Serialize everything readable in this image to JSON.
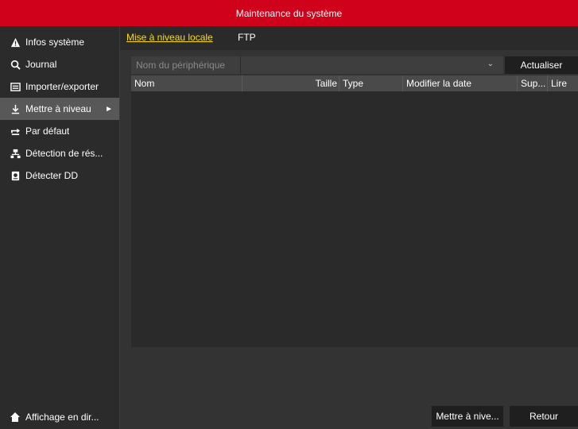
{
  "title": "Maintenance du système",
  "sidebar": {
    "items": [
      {
        "label": "Infos système",
        "icon": "warning-icon"
      },
      {
        "label": "Journal",
        "icon": "search-icon"
      },
      {
        "label": "Importer/exporter",
        "icon": "import-export-icon"
      },
      {
        "label": "Mettre à niveau",
        "icon": "download-icon",
        "active": true
      },
      {
        "label": "Par défaut",
        "icon": "reset-icon"
      },
      {
        "label": "Détection de rés...",
        "icon": "network-icon"
      },
      {
        "label": "Détecter DD",
        "icon": "disk-icon"
      }
    ],
    "live_view_label": "Affichage en dir..."
  },
  "tabs": [
    {
      "label": "Mise à niveau locale",
      "active": true
    },
    {
      "label": "FTP",
      "active": false
    }
  ],
  "device": {
    "label": "Nom du périphérique",
    "selected": ""
  },
  "refresh_label": "Actualiser",
  "table": {
    "columns": [
      "Nom",
      "Taille",
      "Type",
      "Modifier la date",
      "Sup...",
      "Lire"
    ],
    "rows": []
  },
  "buttons": {
    "upgrade": "Mettre à nive...",
    "back": "Retour"
  },
  "colors": {
    "title_bar": "#d0021b",
    "active_tab": "#ffde00",
    "background": "#333333"
  }
}
